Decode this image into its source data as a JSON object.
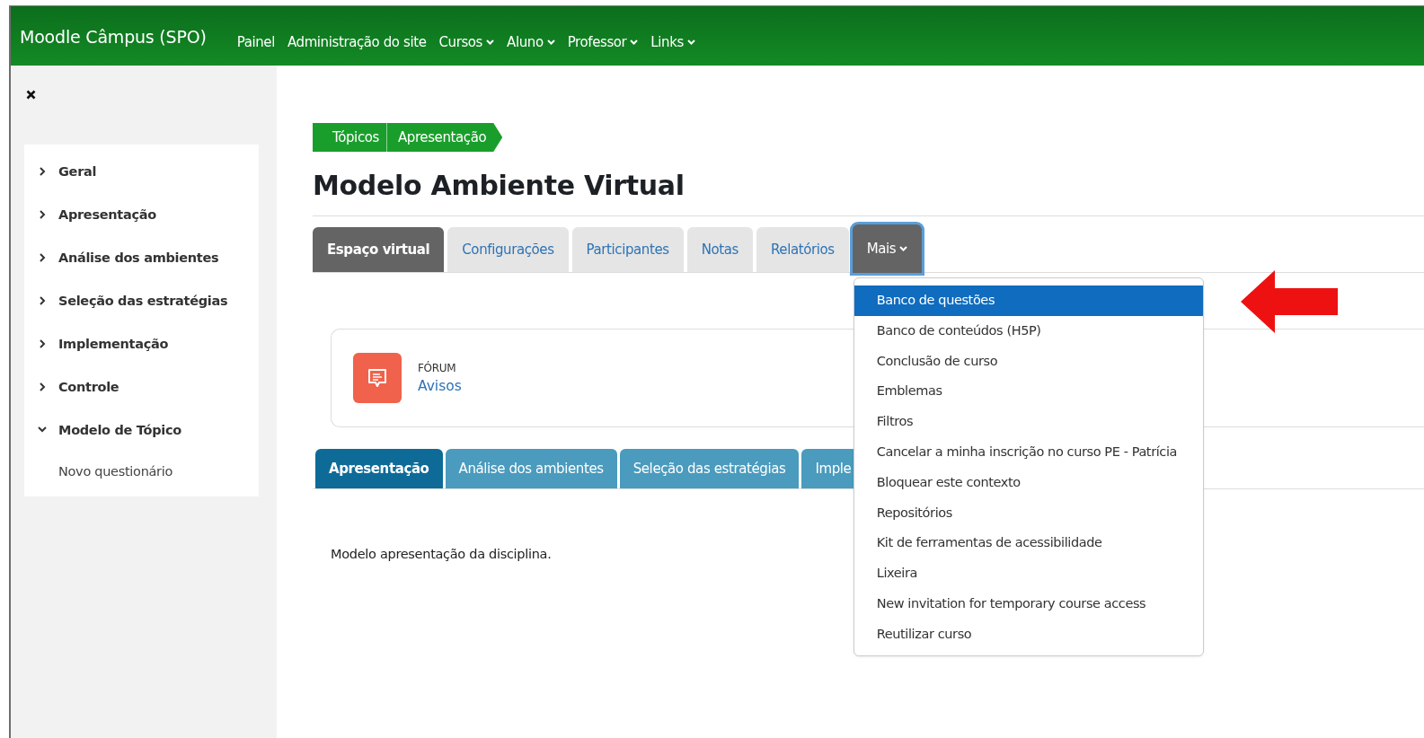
{
  "navbar": {
    "brand": "Moodle Câmpus (SPO)",
    "items": [
      {
        "label": "Painel",
        "dropdown": false
      },
      {
        "label": "Administração do site",
        "dropdown": false
      },
      {
        "label": "Cursos",
        "dropdown": true
      },
      {
        "label": "Aluno",
        "dropdown": true
      },
      {
        "label": "Professor",
        "dropdown": true
      },
      {
        "label": "Links",
        "dropdown": true
      }
    ]
  },
  "sidebar": {
    "items": [
      {
        "label": "Geral",
        "expanded": false
      },
      {
        "label": "Apresentação",
        "expanded": false
      },
      {
        "label": "Análise dos ambientes",
        "expanded": false
      },
      {
        "label": "Seleção das estratégias",
        "expanded": false
      },
      {
        "label": "Implementação",
        "expanded": false
      },
      {
        "label": "Controle",
        "expanded": false
      },
      {
        "label": "Modelo de Tópico",
        "expanded": true,
        "children": [
          {
            "label": "Novo questionário"
          }
        ]
      }
    ]
  },
  "breadcrumb": [
    "Tópicos",
    "Apresentação"
  ],
  "title": "Modelo Ambiente Virtual",
  "tabs": [
    {
      "label": "Espaço virtual",
      "selected": true,
      "kind": "tab"
    },
    {
      "label": "Configurações",
      "selected": false,
      "kind": "tab"
    },
    {
      "label": "Participantes",
      "selected": false,
      "kind": "tab"
    },
    {
      "label": "Notas",
      "selected": false,
      "kind": "tab"
    },
    {
      "label": "Relatórios",
      "selected": false,
      "kind": "tab"
    },
    {
      "label": "Mais",
      "selected": false,
      "kind": "menu",
      "expanded": true
    }
  ],
  "menu": {
    "items": [
      {
        "label": "Banco de questões",
        "selected": true
      },
      {
        "label": "Banco de conteúdos (H5P)",
        "selected": false
      },
      {
        "label": "Conclusão de curso",
        "selected": false
      },
      {
        "label": "Emblemas",
        "selected": false
      },
      {
        "label": "Filtros",
        "selected": false
      },
      {
        "label": "Cancelar a minha inscrição no curso PE - Patrícia",
        "selected": false
      },
      {
        "label": "Bloquear este contexto",
        "selected": false
      },
      {
        "label": "Repositórios",
        "selected": false
      },
      {
        "label": "Kit de ferramentas de acessibilidade",
        "selected": false
      },
      {
        "label": "Lixeira",
        "selected": false
      },
      {
        "label": "New invitation for temporary course access",
        "selected": false
      },
      {
        "label": "Reutilizar curso",
        "selected": false
      }
    ]
  },
  "activity": {
    "type": "FÓRUM",
    "name": "Avisos"
  },
  "section_tabs": [
    {
      "label": "Apresentação",
      "selected": true
    },
    {
      "label": "Análise dos ambientes",
      "selected": false
    },
    {
      "label": "Seleção das estratégias",
      "selected": false
    },
    {
      "label": "Imple",
      "selected": false
    }
  ],
  "summary": "Modelo apresentação da disciplina."
}
